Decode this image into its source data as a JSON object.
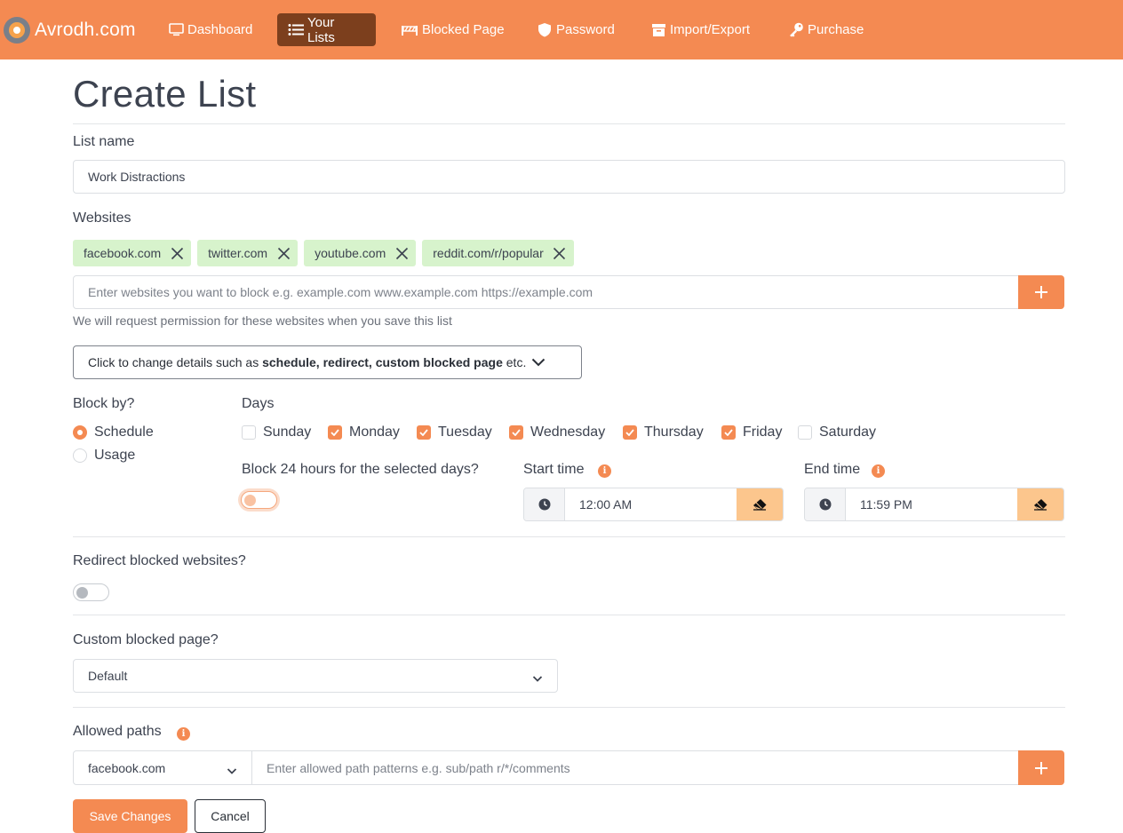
{
  "brand": {
    "name": "Avrodh.com"
  },
  "nav": {
    "items": [
      {
        "label": "Dashboard",
        "icon": "monitor-icon"
      },
      {
        "label": "Your Lists",
        "icon": "list-icon",
        "active": true
      },
      {
        "label": "Blocked Page",
        "icon": "barrier-icon"
      },
      {
        "label": "Password",
        "icon": "shield-icon"
      },
      {
        "label": "Import/Export",
        "icon": "archive-icon"
      },
      {
        "label": "Purchase",
        "icon": "key-icon"
      }
    ]
  },
  "page": {
    "title": "Create List"
  },
  "list_name": {
    "label": "List name",
    "value": "Work Distractions"
  },
  "websites": {
    "label": "Websites",
    "tags": [
      "facebook.com",
      "twitter.com",
      "youtube.com",
      "reddit.com/r/popular"
    ],
    "placeholder": "Enter websites you want to block e.g. example.com www.example.com https://example.com",
    "help": "We will request permission for these websites when you save this list"
  },
  "details_toggle": {
    "prefix": "Click to change details such as ",
    "bold": "schedule, redirect, custom blocked page",
    "suffix": " etc."
  },
  "block_by": {
    "label": "Block by?",
    "options": [
      {
        "label": "Schedule",
        "selected": true
      },
      {
        "label": "Usage",
        "selected": false
      }
    ]
  },
  "days": {
    "label": "Days",
    "items": [
      {
        "label": "Sunday",
        "checked": false
      },
      {
        "label": "Monday",
        "checked": true
      },
      {
        "label": "Tuesday",
        "checked": true
      },
      {
        "label": "Wednesday",
        "checked": true
      },
      {
        "label": "Thursday",
        "checked": true
      },
      {
        "label": "Friday",
        "checked": true
      },
      {
        "label": "Saturday",
        "checked": false
      }
    ]
  },
  "block_24h": {
    "label": "Block 24 hours for the selected days?",
    "enabled": false
  },
  "start_time": {
    "label": "Start time",
    "value": "12:00 AM"
  },
  "end_time": {
    "label": "End time",
    "value": "11:59 PM"
  },
  "redirect": {
    "label": "Redirect blocked websites?",
    "enabled": false
  },
  "custom_page": {
    "label": "Custom blocked page?",
    "value": "Default"
  },
  "allowed_paths": {
    "label": "Allowed paths",
    "site_select": "facebook.com",
    "placeholder": "Enter allowed path patterns e.g. sub/path r/*/comments"
  },
  "actions": {
    "save": "Save Changes",
    "cancel": "Cancel"
  },
  "colors": {
    "accent": "#f48a52",
    "active_nav": "#7c3f1d",
    "tag_bg": "#d7f3cc",
    "clear_btn": "#fcc68d"
  }
}
